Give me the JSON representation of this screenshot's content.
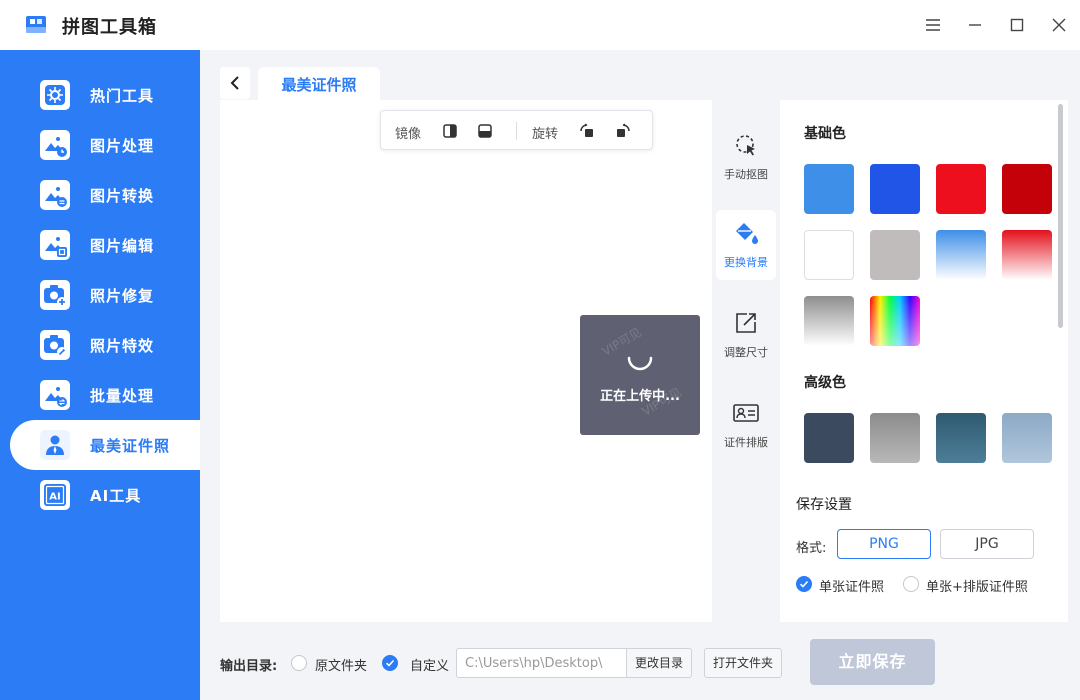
{
  "app": {
    "title": "拼图工具箱",
    "logo_icon": "toolbox-logo-icon"
  },
  "window_controls": [
    "menu-icon",
    "minimize-icon",
    "maximize-icon",
    "close-icon"
  ],
  "colors": {
    "accent": "#2b7cf5",
    "sidebar": "#2b7cf5",
    "loading_bg": "#5f6172",
    "save_disabled": "#bfc7d8"
  },
  "sidebar": {
    "items": [
      {
        "label": "热门工具",
        "icon": "hot-tools-icon"
      },
      {
        "label": "图片处理",
        "icon": "image-process-icon"
      },
      {
        "label": "图片转换",
        "icon": "image-convert-icon"
      },
      {
        "label": "图片编辑",
        "icon": "image-edit-icon"
      },
      {
        "label": "照片修复",
        "icon": "photo-repair-icon"
      },
      {
        "label": "照片特效",
        "icon": "photo-effects-icon"
      },
      {
        "label": "批量处理",
        "icon": "batch-process-icon"
      },
      {
        "label": "最美证件照",
        "icon": "id-photo-icon",
        "active": true
      },
      {
        "label": "AI工具",
        "icon": "ai-tools-icon"
      }
    ]
  },
  "header": {
    "tab": "最美证件照"
  },
  "toolbar": {
    "mirror": "镜像",
    "rotate": "旋转"
  },
  "loading": {
    "text": "正在上传中...",
    "watermark": "VIP可见"
  },
  "tools": [
    {
      "label": "手动抠图",
      "icon": "manual-cutout-icon"
    },
    {
      "label": "更换背景",
      "icon": "paint-bucket-icon",
      "active": true
    },
    {
      "label": "调整尺寸",
      "icon": "resize-icon"
    },
    {
      "label": "证件排版",
      "icon": "id-card-layout-icon"
    }
  ],
  "panel": {
    "basic_title": "基础色",
    "basic_colors": [
      "#3d8fe8",
      "#2155e8",
      "#ee0f1e",
      "#c40008",
      "#ffffff",
      "#c0bcbc",
      "gradient-blue",
      "gradient-red",
      "gradient-gray",
      "rainbow"
    ],
    "advanced_title": "高级色",
    "advanced_colors": [
      "#3b4a5e",
      "#8c8c8c",
      "#3c677f",
      "#97b1cc"
    ],
    "save_title": "保存设置",
    "format_label": "格式:",
    "format_png": "PNG",
    "format_jpg": "JPG",
    "option_single": "单张证件照",
    "option_layout": "单张+排版证件照"
  },
  "bottom": {
    "output_label": "输出目录:",
    "opt_original": "原文件夹",
    "opt_custom": "自定义",
    "path_value": "C:\\Users\\hp\\Desktop\\",
    "change_dir": "更改目录",
    "open_folder": "打开文件夹",
    "save": "立即保存"
  }
}
